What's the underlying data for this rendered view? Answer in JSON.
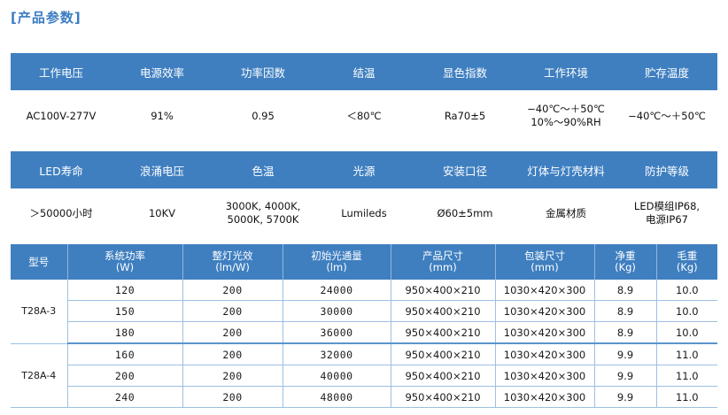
{
  "title": "[产品参数]",
  "band1": {
    "headers": [
      "工作电压",
      "电源效率",
      "功率因数",
      "结温",
      "显色指数",
      "工作环境",
      "贮存温度"
    ],
    "values": [
      "AC100V-277V",
      "91%",
      "0.95",
      "＜80℃",
      "Ra70±5",
      "−40℃～＋50℃\n10%～90%RH",
      "−40℃～＋50℃"
    ]
  },
  "band2": {
    "headers": [
      "LED寿命",
      "浪涌电压",
      "色温",
      "光源",
      "安装口径",
      "灯体与灯壳材料",
      "防护等级"
    ],
    "values": [
      "＞50000小时",
      "10KV",
      "3000K, 4000K,\n5000K, 5700K",
      "Lumileds",
      "Ø60±5mm",
      "金属材质",
      "LED模组IP68,\n电源IP67"
    ]
  },
  "table": {
    "headers": [
      "型号",
      "系统功率\n(W)",
      "整灯光效\n(lm/W)",
      "初始光通量\n(lm)",
      "产品尺寸\n(mm)",
      "包装尺寸\n(mm)",
      "净重\n(Kg)",
      "毛重\n(Kg)"
    ],
    "groups": [
      {
        "model": "T28A-3",
        "rows": [
          [
            "120",
            "200",
            "24000",
            "950×400×210",
            "1030×420×300",
            "8.9",
            "10.0"
          ],
          [
            "150",
            "200",
            "30000",
            "950×400×210",
            "1030×420×300",
            "8.9",
            "10.0"
          ],
          [
            "180",
            "200",
            "36000",
            "950×400×210",
            "1030×420×300",
            "8.9",
            "10.0"
          ]
        ]
      },
      {
        "model": "T28A-4",
        "rows": [
          [
            "160",
            "200",
            "32000",
            "950×400×210",
            "1030×420×300",
            "9.9",
            "11.0"
          ],
          [
            "200",
            "200",
            "40000",
            "950×400×210",
            "1030×420×300",
            "9.9",
            "11.0"
          ],
          [
            "240",
            "200",
            "48000",
            "950×400×210",
            "1030×420×300",
            "9.9",
            "11.0"
          ]
        ]
      }
    ]
  }
}
